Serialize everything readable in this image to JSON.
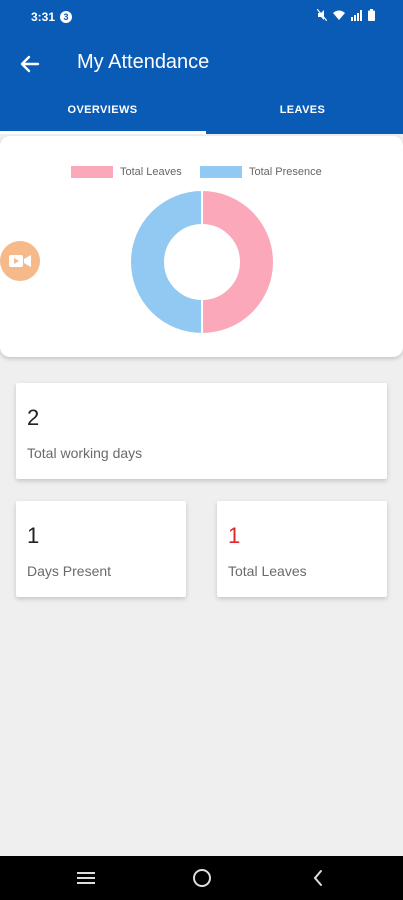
{
  "status_bar": {
    "time": "3:31",
    "notification_count": "3"
  },
  "app_bar": {
    "title": "My Attendance",
    "back_icon": "arrow-left-icon"
  },
  "tabs": [
    {
      "label": "OVERVIEWS",
      "selected": true
    },
    {
      "label": "LEAVES",
      "selected": false
    }
  ],
  "chart_data": {
    "type": "pie",
    "donut": true,
    "legend_position": "top",
    "categories": [
      "Total Leaves",
      "Total Presence"
    ],
    "values": [
      1,
      1
    ],
    "colors": [
      "#fba8ba",
      "#92c9f2"
    ]
  },
  "stats": {
    "total_working_days": {
      "value": "2",
      "label": "Total working days"
    },
    "days_present": {
      "value": "1",
      "label": "Days Present"
    },
    "total_leaves": {
      "value": "1",
      "label": "Total Leaves",
      "value_color": "#e0262b"
    }
  },
  "colors": {
    "primary": "#0a5bb5",
    "background": "#efefef",
    "fab": "#f5b98a"
  },
  "nav_bar": {
    "icons": [
      "menu-icon",
      "home-circle-icon",
      "back-chevron-icon"
    ]
  }
}
